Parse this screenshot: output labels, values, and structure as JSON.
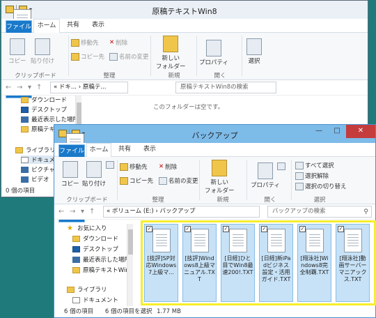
{
  "window1": {
    "title": "原稿テキストWin8",
    "tabs": {
      "file": "ファイル",
      "home": "ホーム",
      "share": "共有",
      "view": "表示"
    },
    "ribbon": {
      "copy": "コピー",
      "paste": "貼り付け",
      "move_to": "移動先",
      "delete": "削除",
      "copy_to": "コピー先",
      "rename": "名前の変更",
      "new_folder": "新しい\nフォルダー",
      "properties": "プロパティ",
      "select": "選択",
      "group_clipboard": "クリップボード",
      "group_organize": "整理",
      "group_new": "新規",
      "group_open": "開く"
    },
    "address": {
      "overflow": "«",
      "part1": "ドキ...",
      "part2": "原稿テ..."
    },
    "search_placeholder": "原稿テキストWin8の検索",
    "empty_message": "このフォルダーは空です。",
    "nav": [
      "ダウンロード",
      "デスクトップ",
      "最近表示した場所",
      "原稿テキストWin8",
      "ライブラリ",
      "ドキュメント",
      "ピクチャ",
      "ビデオ"
    ],
    "status": "0 個の項目"
  },
  "window2": {
    "title": "バックアップ",
    "tabs": {
      "file": "ファイル",
      "home": "ホーム",
      "share": "共有",
      "view": "表示"
    },
    "ribbon": {
      "copy": "コピー",
      "paste": "貼り付け",
      "move_to": "移動先",
      "delete": "削除",
      "copy_to": "コピー先",
      "rename": "名前の変更",
      "new_folder": "新しい\nフォルダー",
      "properties": "プロパティ",
      "select_all": "すべて選択",
      "select_none": "選択解除",
      "invert_selection": "選択の切り替え",
      "group_clipboard": "クリップボード",
      "group_organize": "整理",
      "group_new": "新規",
      "group_open": "開く",
      "group_select": "選択"
    },
    "address": {
      "overflow": "«",
      "part1": "ボリューム (E:)",
      "part2": "バックアップ"
    },
    "search_placeholder": "バックアップの検索",
    "nav": [
      "お気に入り",
      "ダウンロード",
      "デスクトップ",
      "最近表示した場所",
      "原稿テキストWin8",
      "ライブラリ",
      "ドキュメント"
    ],
    "files": [
      "[技評]SP対応Windows7上級マ...",
      "[技評]Windows8上級マニュアル.TXT",
      "[日経]ひと目でWin8最速200!.TXT",
      "[日経]新iPadビジネス設定・活用ガイド.TXT",
      "[翔泳社]Windows8完全制覇.TXT",
      "[翔泳社]動画サーバーマニアックス.TXT"
    ],
    "status_count": "6 個の項目",
    "status_selected": "6 個の項目を選択",
    "status_size": "1.77 MB"
  }
}
